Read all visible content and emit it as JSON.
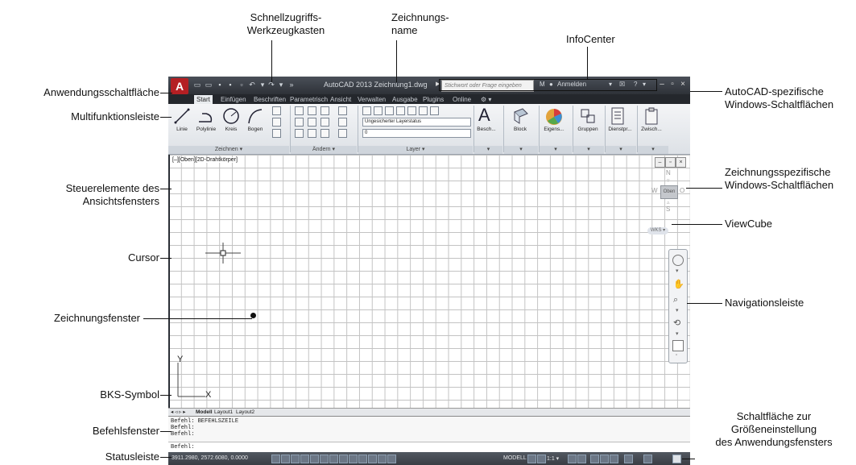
{
  "annotations": {
    "quick_access": [
      "Schnellzugriffs-",
      "Werkzeugkasten"
    ],
    "drawing_name": [
      "Zeichnungs-",
      "name"
    ],
    "infocenter": "InfoCenter",
    "app_button": "Anwendungsschaltfläche",
    "ribbon": "Multifunktionsleiste",
    "autocad_win_btns": [
      "AutoCAD-spezifische",
      "Windows-Schaltflächen"
    ],
    "drawing_win_btns": [
      "Zeichnungsspezifische",
      "Windows-Schaltflächen"
    ],
    "viewport_controls": [
      "Steuerelemente des",
      "Ansichtsfensters"
    ],
    "viewcube": "ViewCube",
    "cursor": "Cursor",
    "navbar": "Navigationsleiste",
    "drawing_window": "Zeichnungsfenster",
    "ucs_icon": "BKS-Symbol",
    "command_window": "Befehlsfenster",
    "status_bar": "Statusleiste",
    "resize_button": [
      "Schaltfläche zur",
      "Größeneinstellung",
      "des Anwendungsfensters"
    ]
  },
  "app": {
    "logo": "A",
    "title": "AutoCAD 2013   Zeichnung1.dwg",
    "search_placeholder": "Stichwort oder Frage eingeben",
    "login": "Anmelden",
    "tabs": [
      "Start",
      "Einfügen",
      "Beschriften",
      "Parametrisch",
      "Ansicht",
      "Verwalten",
      "Ausgabe",
      "Plugins",
      "Online",
      "⚙ ▾"
    ],
    "active_tab": "Start",
    "tools": {
      "linie": "Linie",
      "polylinie": "Polylinie",
      "kreis": "Kreis",
      "bogen": "Bogen",
      "layer_state": "Ungesicherter Layerstatus",
      "layer_name": "0",
      "text": "Besch...",
      "block": "Block",
      "eigenschaften": "Eigens...",
      "gruppen": "Gruppen",
      "dienstprogramme": "Dienstpr...",
      "zwischenablage": "Zwisch..."
    },
    "panels": {
      "zeichnen": "Zeichnen ▾",
      "aendern": "Ändern ▾",
      "layer": "Layer ▾"
    },
    "viewport_label": "[–][Oben][2D-Drahtkörper]",
    "viewcube": {
      "n": "N",
      "w": "W",
      "face": "Oben",
      "s": "S",
      "e": "O",
      "wcs": "WKS ▾"
    },
    "ucs": {
      "x": "X",
      "y": "Y"
    },
    "layout_tabs": [
      "Modell",
      "Layout1",
      "Layout2"
    ],
    "command_lines": [
      "Befehl:  BEFEHLSZEILE",
      "Befehl:",
      "Befehl:"
    ],
    "command_prompt": "Befehl:",
    "coords": "3911.2980, 2572.6080, 0.0000",
    "modell": "MODELL",
    "scale": "1:1 ▾"
  }
}
